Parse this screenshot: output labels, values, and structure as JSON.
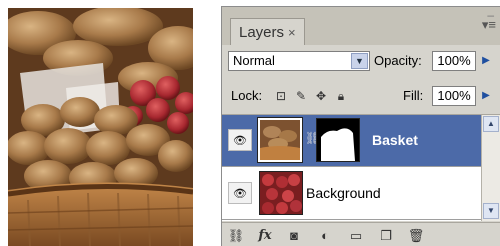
{
  "panel": {
    "tab_label": "Layers",
    "tab_close": "×",
    "collapse_glyph": "–",
    "menu_glyph": "▾≡",
    "blend_mode": "Normal",
    "opacity_label": "Opacity:",
    "opacity_value": "100%",
    "lock_label": "Lock:",
    "fill_label": "Fill:",
    "fill_value": "100%",
    "lock_icons": [
      "lock-transparent-icon",
      "lock-image-icon",
      "lock-position-icon",
      "lock-all-icon"
    ]
  },
  "layers": [
    {
      "name": "Basket",
      "selected": true,
      "visible": true,
      "has_mask": true
    },
    {
      "name": "Background",
      "selected": false,
      "visible": true,
      "has_mask": false
    }
  ],
  "footer_icons": [
    "link-layers-icon",
    "layer-style-icon",
    "add-mask-icon",
    "adjustment-layer-icon",
    "new-group-icon",
    "new-layer-icon",
    "delete-layer-icon"
  ],
  "footer_glyphs": {
    "fx": "fx"
  },
  "colors": {
    "selection": "#4c6aa8",
    "panel_bg": "#d6d4cd"
  }
}
